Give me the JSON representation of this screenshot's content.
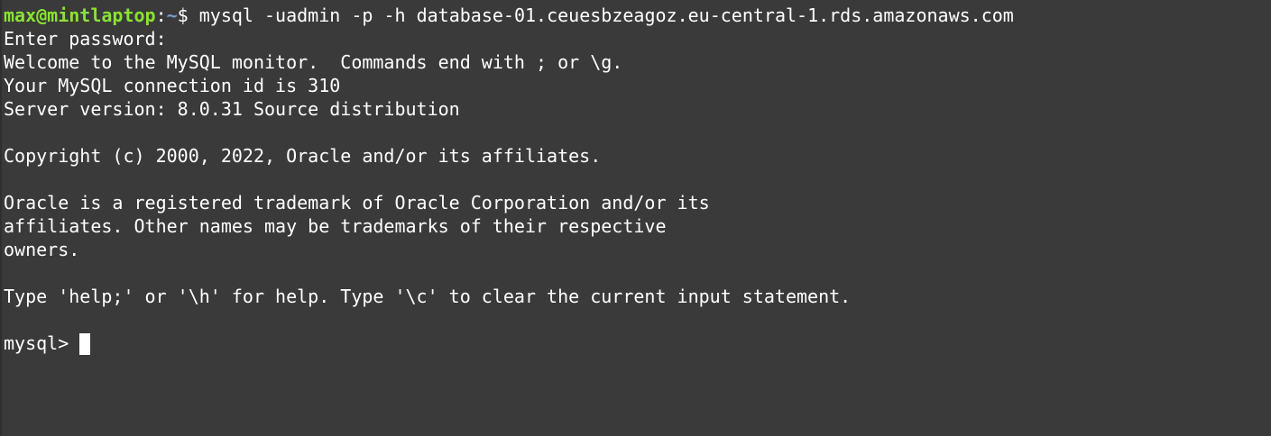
{
  "prompt": {
    "user_host": "max@mintlaptop",
    "separator": ":",
    "path": "~",
    "symbol": "$ ",
    "command": "mysql -uadmin -p -h database-01.ceuesbzeagoz.eu-central-1.rds.amazonaws.com"
  },
  "output": {
    "enter_password": "Enter password:",
    "welcome": "Welcome to the MySQL monitor.  Commands end with ; or \\g.",
    "connection_id": "Your MySQL connection id is 310",
    "server_version": "Server version: 8.0.31 Source distribution",
    "copyright": "Copyright (c) 2000, 2022, Oracle and/or its affiliates.",
    "trademark_1": "Oracle is a registered trademark of Oracle Corporation and/or its",
    "trademark_2": "affiliates. Other names may be trademarks of their respective",
    "trademark_3": "owners.",
    "help": "Type 'help;' or '\\h' for help. Type '\\c' to clear the current input statement."
  },
  "mysql_prompt": "mysql> ",
  "colors": {
    "background": "#3a3a3a",
    "text": "#ffffff",
    "user_host": "#8ae234",
    "path": "#729fcf"
  }
}
